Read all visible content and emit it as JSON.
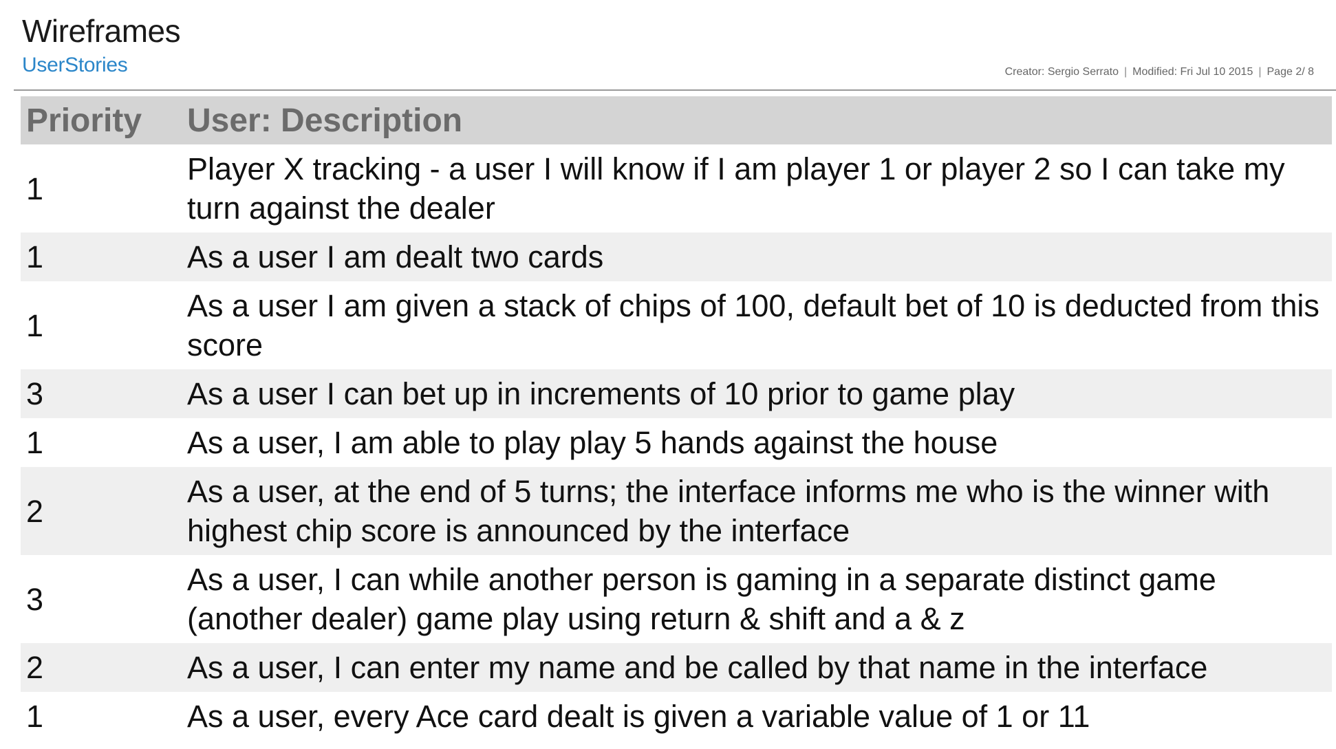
{
  "header": {
    "title": "Wireframes",
    "subtitle": "UserStories",
    "creator": "Creator: Sergio Serrato",
    "modified": "Modified: Fri Jul 10 2015",
    "page": "Page 2/ 8",
    "separator": "|"
  },
  "table": {
    "columns": [
      "Priority",
      "User: Description"
    ],
    "rows": [
      {
        "priority": "1",
        "description": "Player X tracking - a user I will know if I am player 1 or player 2 so I can take my turn against the dealer"
      },
      {
        "priority": "1",
        "description": "As a user I am dealt two cards"
      },
      {
        "priority": "1",
        "description": "As a user I am given a stack of chips of 100, default bet of 10 is deducted from this score"
      },
      {
        "priority": "3",
        "description": "As a user I can bet up in increments of 10 prior to game play"
      },
      {
        "priority": "1",
        "description": "As a user, I am able to play play 5 hands against the house"
      },
      {
        "priority": "2",
        "description": "As a user, at the end of 5 turns; the interface informs me who is the winner with highest chip score is announced by the interface"
      },
      {
        "priority": "3",
        "description": "As a user, I can while another person is gaming in a separate distinct game (another dealer) game play using return & shift and a & z"
      },
      {
        "priority": "2",
        "description": "As a user, I can enter my name and be called by that name in the interface"
      },
      {
        "priority": "1",
        "description": "As a user, every Ace card dealt is given a variable value of 1 or 11"
      }
    ]
  }
}
